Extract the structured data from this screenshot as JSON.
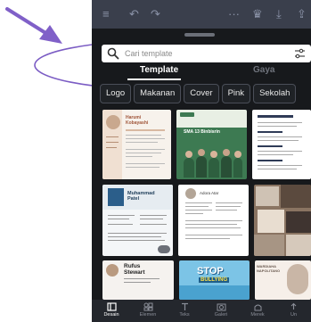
{
  "search": {
    "placeholder": "Cari template"
  },
  "tabs": [
    {
      "label": "Template",
      "active": true
    },
    {
      "label": "Gaya",
      "active": false
    }
  ],
  "categories": [
    "Logo",
    "Makanan",
    "Cover",
    "Pink",
    "Sekolah"
  ],
  "templates": [
    {
      "name_line1": "Harumi",
      "name_line2": "Kobayashi"
    },
    {
      "title": "SMA 13 Binbisrin"
    },
    {
      "title": ""
    },
    {
      "name_line1": "Muhammad",
      "name_line2": "Patel"
    },
    {
      "title": "Adora Atar"
    },
    {
      "title": ""
    },
    {
      "name_line1": "Rufus",
      "name_line2": "Stewart"
    },
    {
      "title_line1": "STOP",
      "title_line2": "BULLYING"
    },
    {
      "title_line1": "WARDIAHA",
      "title_line2": "NAPOLITANO"
    }
  ],
  "bottom_nav": [
    {
      "label": "Desain",
      "icon": "design-icon",
      "active": true
    },
    {
      "label": "Elemen",
      "icon": "elements-icon",
      "active": false
    },
    {
      "label": "Teks",
      "icon": "text-icon",
      "active": false
    },
    {
      "label": "Galeri",
      "icon": "gallery-icon",
      "active": false
    },
    {
      "label": "Merek",
      "icon": "brand-icon",
      "active": false
    },
    {
      "label": "Un",
      "icon": "upload-icon",
      "active": false
    }
  ],
  "colors": {
    "background": "#17191c",
    "topbar": "#3a3f4c",
    "annotation": "#7b5cc4"
  }
}
